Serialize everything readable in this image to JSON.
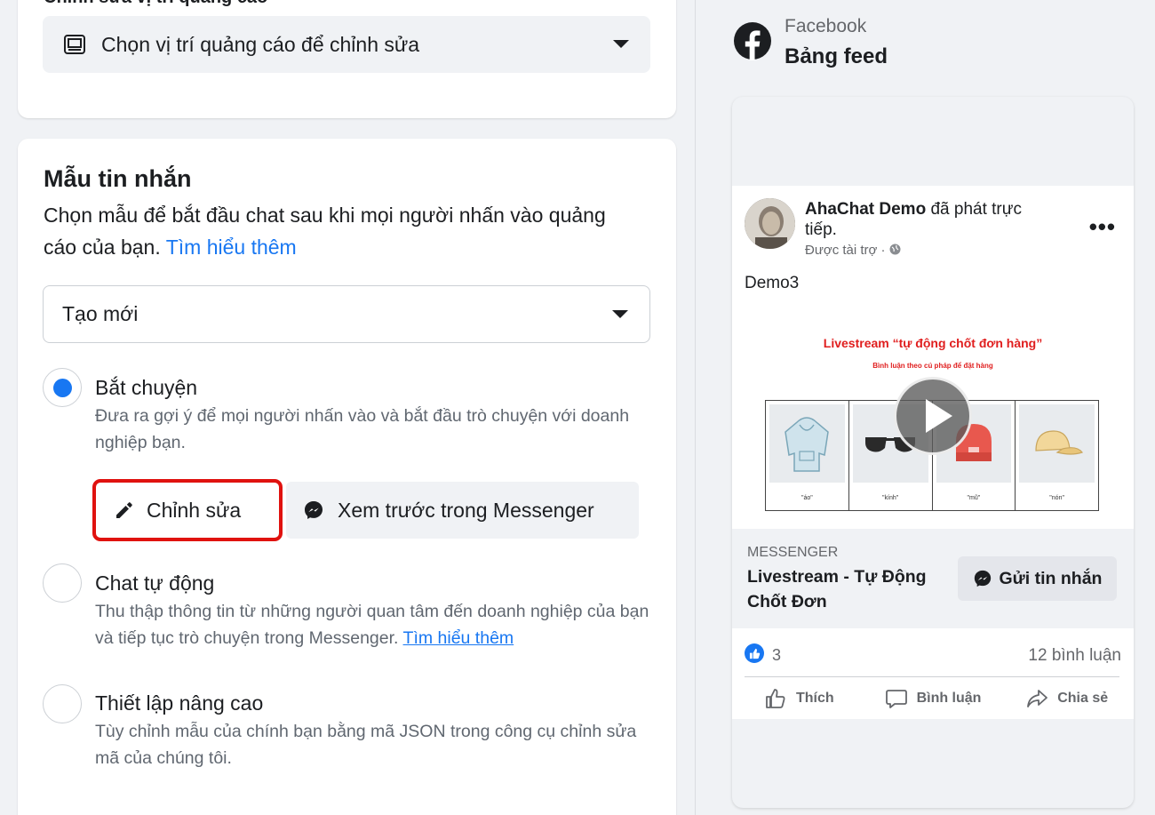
{
  "placement": {
    "title": "Chỉnh sửa vị trí quảng cáo",
    "select_label": "Chọn vị trí quảng cáo để chỉnh sửa"
  },
  "message_template": {
    "title": "Mẫu tin nhắn",
    "description": "Chọn mẫu để bắt đầu chat sau khi mọi người nhấn vào quảng cáo của bạn.",
    "learn_more": "Tìm hiểu thêm",
    "template_select": "Tạo mới",
    "options": [
      {
        "title": "Bắt chuyện",
        "description": "Đưa ra gợi ý để mọi người nhấn vào và bắt đầu trò chuyện với doanh nghiệp bạn.",
        "checked": true
      },
      {
        "title": "Chat tự động",
        "description": "Thu thập thông tin từ những người quan tâm đến doanh nghiệp của bạn và tiếp tục trò chuyện trong Messenger.",
        "learn_more": "Tìm hiểu thêm",
        "checked": false
      },
      {
        "title": "Thiết lập nâng cao",
        "description": "Tùy chỉnh mẫu của chính bạn bằng mã JSON trong công cụ chỉnh sửa mã của chúng tôi.",
        "checked": false
      }
    ],
    "edit_button": "Chỉnh sửa",
    "preview_button": "Xem trước trong Messenger"
  },
  "preview": {
    "platform": "Facebook",
    "placement": "Bảng feed",
    "author": "AhaChat Demo",
    "author_action": "đã phát trực tiếp.",
    "sponsored": "Được tài trợ ·",
    "post_text": "Demo3",
    "media": {
      "title": "Livestream “tự động chốt đơn hàng”",
      "subtitle": "Bình luận theo cú pháp để đặt hàng",
      "items": [
        "\"áo\"",
        "\"kính\"",
        "\"mũ\"",
        "\"nón\""
      ]
    },
    "cta_kind": "MESSENGER",
    "cta_title": "Livestream - Tự Động Chốt Đơn",
    "cta_button": "Gửi tin nhắn",
    "like_count": "3",
    "comment_count": "12 bình luận",
    "actions": [
      "Thích",
      "Bình luận",
      "Chia sẻ"
    ]
  },
  "colors": {
    "accent": "#1877f2",
    "highlight_box": "#e0120f"
  }
}
